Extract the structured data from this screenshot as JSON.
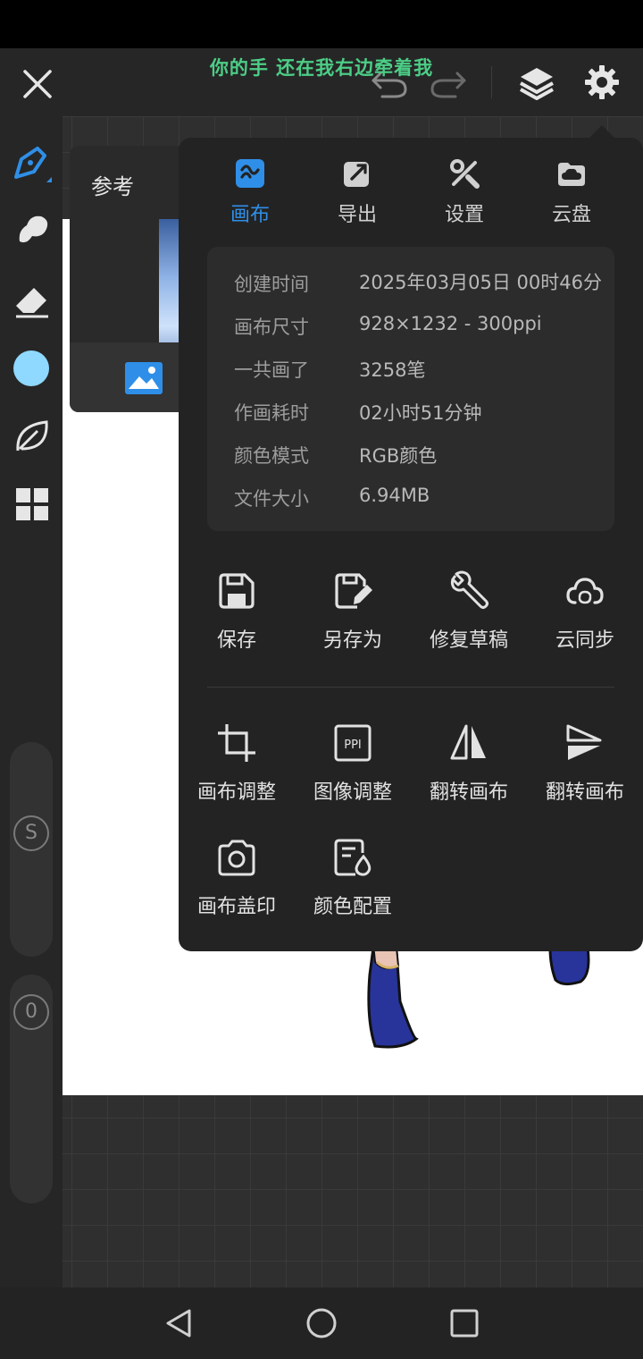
{
  "lyric": "你的手 还在我右边牵着我",
  "reference": {
    "label": "参考"
  },
  "menu": {
    "tabs": [
      {
        "label": "画布",
        "icon": "canvas-icon",
        "active": true
      },
      {
        "label": "导出",
        "icon": "export-icon",
        "active": false
      },
      {
        "label": "设置",
        "icon": "tools-icon",
        "active": false
      },
      {
        "label": "云盘",
        "icon": "cloud-drive-icon",
        "active": false
      }
    ],
    "info": [
      {
        "key": "创建时间",
        "value": "2025年03月05日 00时46分"
      },
      {
        "key": "画布尺寸",
        "value": "928×1232 - 300ppi"
      },
      {
        "key": "一共画了",
        "value": "3258笔"
      },
      {
        "key": "作画耗时",
        "value": "02小时51分钟"
      },
      {
        "key": "颜色模式",
        "value": "RGB颜色"
      },
      {
        "key": "文件大小",
        "value": "6.94MB"
      }
    ],
    "actions_row1": [
      {
        "label": "保存",
        "icon": "save-icon"
      },
      {
        "label": "另存为",
        "icon": "save-as-icon"
      },
      {
        "label": "修复草稿",
        "icon": "wrench-icon"
      },
      {
        "label": "云同步",
        "icon": "cloud-sync-icon"
      }
    ],
    "actions_row2": [
      {
        "label": "画布调整",
        "icon": "crop-icon"
      },
      {
        "label": "图像调整",
        "icon": "ppi-icon"
      },
      {
        "label": "翻转画布",
        "icon": "flip-horizontal-icon"
      },
      {
        "label": "翻转画布",
        "icon": "flip-vertical-icon"
      }
    ],
    "actions_row3": [
      {
        "label": "画布盖印",
        "icon": "camera-icon"
      },
      {
        "label": "颜色配置",
        "icon": "color-profile-icon"
      }
    ]
  },
  "sidebar": {
    "size_badge": "S",
    "opacity_badge": "0"
  },
  "colors": {
    "accent": "#2f8fe8",
    "current_color": "#8fd8ff",
    "lyric": "#4cce86",
    "menu_bg": "#232323"
  }
}
